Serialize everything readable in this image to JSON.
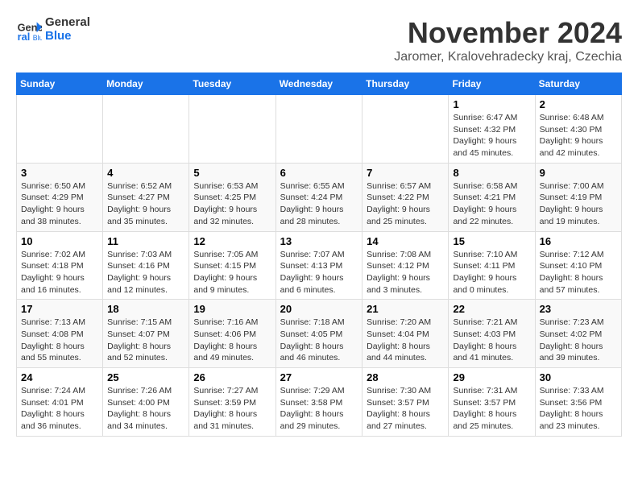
{
  "logo": {
    "line1": "General",
    "line2": "Blue"
  },
  "header": {
    "month": "November 2024",
    "location": "Jaromer, Kralovehradecky kraj, Czechia"
  },
  "days_of_week": [
    "Sunday",
    "Monday",
    "Tuesday",
    "Wednesday",
    "Thursday",
    "Friday",
    "Saturday"
  ],
  "weeks": [
    [
      {
        "day": "",
        "info": ""
      },
      {
        "day": "",
        "info": ""
      },
      {
        "day": "",
        "info": ""
      },
      {
        "day": "",
        "info": ""
      },
      {
        "day": "",
        "info": ""
      },
      {
        "day": "1",
        "info": "Sunrise: 6:47 AM\nSunset: 4:32 PM\nDaylight: 9 hours and 45 minutes."
      },
      {
        "day": "2",
        "info": "Sunrise: 6:48 AM\nSunset: 4:30 PM\nDaylight: 9 hours and 42 minutes."
      }
    ],
    [
      {
        "day": "3",
        "info": "Sunrise: 6:50 AM\nSunset: 4:29 PM\nDaylight: 9 hours and 38 minutes."
      },
      {
        "day": "4",
        "info": "Sunrise: 6:52 AM\nSunset: 4:27 PM\nDaylight: 9 hours and 35 minutes."
      },
      {
        "day": "5",
        "info": "Sunrise: 6:53 AM\nSunset: 4:25 PM\nDaylight: 9 hours and 32 minutes."
      },
      {
        "day": "6",
        "info": "Sunrise: 6:55 AM\nSunset: 4:24 PM\nDaylight: 9 hours and 28 minutes."
      },
      {
        "day": "7",
        "info": "Sunrise: 6:57 AM\nSunset: 4:22 PM\nDaylight: 9 hours and 25 minutes."
      },
      {
        "day": "8",
        "info": "Sunrise: 6:58 AM\nSunset: 4:21 PM\nDaylight: 9 hours and 22 minutes."
      },
      {
        "day": "9",
        "info": "Sunrise: 7:00 AM\nSunset: 4:19 PM\nDaylight: 9 hours and 19 minutes."
      }
    ],
    [
      {
        "day": "10",
        "info": "Sunrise: 7:02 AM\nSunset: 4:18 PM\nDaylight: 9 hours and 16 minutes."
      },
      {
        "day": "11",
        "info": "Sunrise: 7:03 AM\nSunset: 4:16 PM\nDaylight: 9 hours and 12 minutes."
      },
      {
        "day": "12",
        "info": "Sunrise: 7:05 AM\nSunset: 4:15 PM\nDaylight: 9 hours and 9 minutes."
      },
      {
        "day": "13",
        "info": "Sunrise: 7:07 AM\nSunset: 4:13 PM\nDaylight: 9 hours and 6 minutes."
      },
      {
        "day": "14",
        "info": "Sunrise: 7:08 AM\nSunset: 4:12 PM\nDaylight: 9 hours and 3 minutes."
      },
      {
        "day": "15",
        "info": "Sunrise: 7:10 AM\nSunset: 4:11 PM\nDaylight: 9 hours and 0 minutes."
      },
      {
        "day": "16",
        "info": "Sunrise: 7:12 AM\nSunset: 4:10 PM\nDaylight: 8 hours and 57 minutes."
      }
    ],
    [
      {
        "day": "17",
        "info": "Sunrise: 7:13 AM\nSunset: 4:08 PM\nDaylight: 8 hours and 55 minutes."
      },
      {
        "day": "18",
        "info": "Sunrise: 7:15 AM\nSunset: 4:07 PM\nDaylight: 8 hours and 52 minutes."
      },
      {
        "day": "19",
        "info": "Sunrise: 7:16 AM\nSunset: 4:06 PM\nDaylight: 8 hours and 49 minutes."
      },
      {
        "day": "20",
        "info": "Sunrise: 7:18 AM\nSunset: 4:05 PM\nDaylight: 8 hours and 46 minutes."
      },
      {
        "day": "21",
        "info": "Sunrise: 7:20 AM\nSunset: 4:04 PM\nDaylight: 8 hours and 44 minutes."
      },
      {
        "day": "22",
        "info": "Sunrise: 7:21 AM\nSunset: 4:03 PM\nDaylight: 8 hours and 41 minutes."
      },
      {
        "day": "23",
        "info": "Sunrise: 7:23 AM\nSunset: 4:02 PM\nDaylight: 8 hours and 39 minutes."
      }
    ],
    [
      {
        "day": "24",
        "info": "Sunrise: 7:24 AM\nSunset: 4:01 PM\nDaylight: 8 hours and 36 minutes."
      },
      {
        "day": "25",
        "info": "Sunrise: 7:26 AM\nSunset: 4:00 PM\nDaylight: 8 hours and 34 minutes."
      },
      {
        "day": "26",
        "info": "Sunrise: 7:27 AM\nSunset: 3:59 PM\nDaylight: 8 hours and 31 minutes."
      },
      {
        "day": "27",
        "info": "Sunrise: 7:29 AM\nSunset: 3:58 PM\nDaylight: 8 hours and 29 minutes."
      },
      {
        "day": "28",
        "info": "Sunrise: 7:30 AM\nSunset: 3:57 PM\nDaylight: 8 hours and 27 minutes."
      },
      {
        "day": "29",
        "info": "Sunrise: 7:31 AM\nSunset: 3:57 PM\nDaylight: 8 hours and 25 minutes."
      },
      {
        "day": "30",
        "info": "Sunrise: 7:33 AM\nSunset: 3:56 PM\nDaylight: 8 hours and 23 minutes."
      }
    ]
  ]
}
